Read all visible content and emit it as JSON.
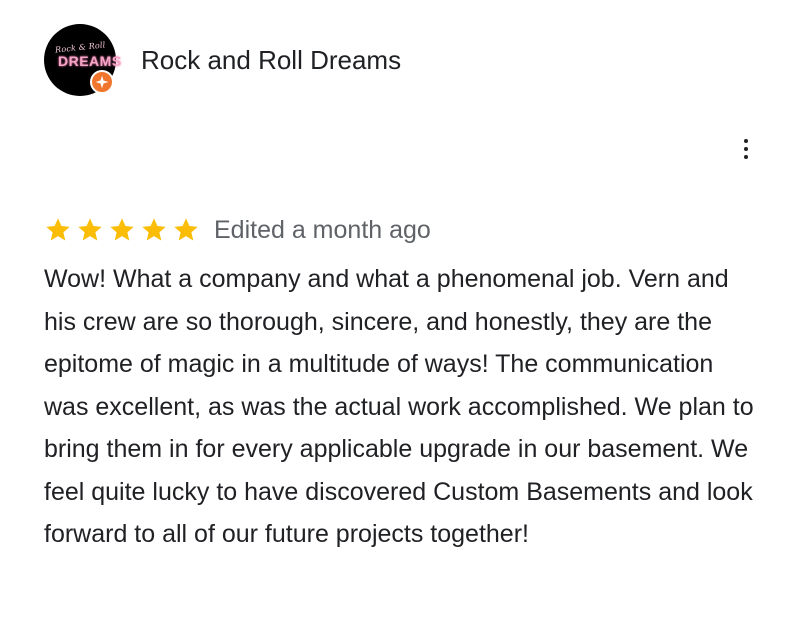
{
  "reviewer": {
    "logo_line1": "Rock & Roll",
    "logo_line2": "DREAMS",
    "name": "Rock and Roll Dreams",
    "badge_icon": "local-guide-star-icon",
    "badge_color": "#f0762e"
  },
  "menu": {
    "icon": "more-vert-icon"
  },
  "review": {
    "rating": 5,
    "rating_max": 5,
    "star_color": "#fbbc04",
    "edited": "Edited a month ago",
    "text": "Wow! What a company and what a phenomenal job. Vern and his crew are so thorough, sincere, and honestly, they are the epitome of magic in a multitude of ways! The communication was excellent, as was the actual work accomplished. We plan to bring them in for every applicable upgrade in our basement. We feel quite lucky to have discovered Custom Basements and look forward to all of our future projects together!"
  }
}
